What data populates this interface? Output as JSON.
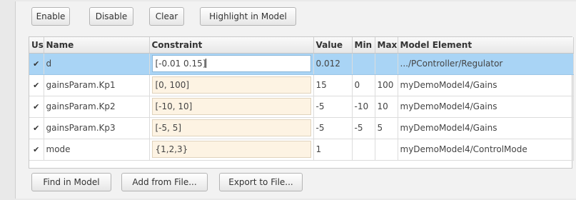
{
  "toolbar_top": {
    "enable_label": "Enable",
    "disable_label": "Disable",
    "clear_label": "Clear",
    "highlight_label": "Highlight in Model"
  },
  "table": {
    "headers": [
      "Use",
      "Name",
      "Constraint",
      "Value",
      "Min",
      "Max",
      "Model Element"
    ],
    "rows": [
      {
        "use": true,
        "name": "d",
        "constraint": "[-0.01 0.15]",
        "value": "0.012",
        "min": "",
        "max": "",
        "element": ".../PController/Regulator",
        "selected": true
      },
      {
        "use": true,
        "name": "gainsParam.Kp1",
        "constraint": "[0, 100]",
        "value": "15",
        "min": "0",
        "max": "100",
        "element": "myDemoModel4/Gains",
        "selected": false
      },
      {
        "use": true,
        "name": "gainsParam.Kp2",
        "constraint": "[-10, 10]",
        "value": "-5",
        "min": "-10",
        "max": "10",
        "element": "myDemoModel4/Gains",
        "selected": false
      },
      {
        "use": true,
        "name": "gainsParam.Kp3",
        "constraint": "[-5, 5]",
        "value": "-5",
        "min": "-5",
        "max": "5",
        "element": "myDemoModel4/Gains",
        "selected": false
      },
      {
        "use": true,
        "name": "mode",
        "constraint": "{1,2,3}",
        "value": "1",
        "min": "",
        "max": "",
        "element": "myDemoModel4/ControlMode",
        "selected": false
      }
    ]
  },
  "toolbar_bottom": {
    "find_label": "Find in Model",
    "add_label": "Add from File...",
    "export_label": "Export to File..."
  },
  "icons": {
    "checkbox": "checkmark-icon"
  }
}
